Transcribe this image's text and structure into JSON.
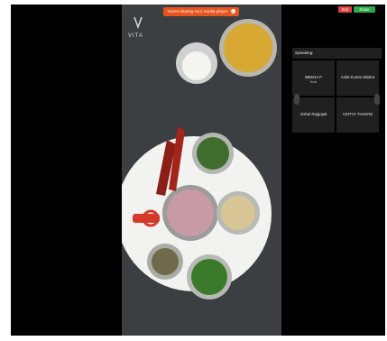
{
  "share_bar": {
    "text": "You're sharing VLC media player",
    "close_icon": "close-icon"
  },
  "logo": {
    "text": "VITA"
  },
  "controls": {
    "end_label": "End",
    "share_label": "Share"
  },
  "panel": {
    "speaking_label": "Speaking:",
    "participants": [
      {
        "name": "MEENA P",
        "sub": "Host"
      },
      {
        "name": "Ankit Kumar Mishra",
        "sub": ""
      },
      {
        "name": "Vishal Rajgopal",
        "sub": ""
      },
      {
        "name": "ADITYA THAKRE",
        "sub": ""
      }
    ]
  }
}
